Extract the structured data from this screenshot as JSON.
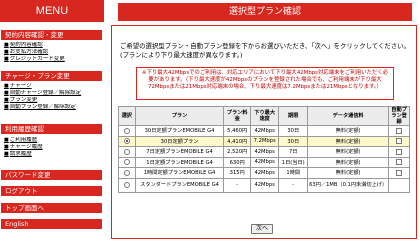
{
  "sidebar": {
    "title": "MENU",
    "sections": [
      {
        "heading": "契約内容確認・変更",
        "links": [
          "契約内容確認",
          "お支払方法確認",
          "クレジットカード変更"
        ]
      },
      {
        "heading": "チャージ・プラン変更",
        "links": [
          "チャージ",
          "自動チャージ登録／解除設定",
          "プラン変更",
          "自動プラン登録／解除設定"
        ]
      },
      {
        "heading": "利用履歴確認",
        "links": [
          "ご利用履歴",
          "チャージ履歴",
          "請求履歴"
        ]
      }
    ],
    "items": [
      "パスワード変更",
      "ログアウト",
      "トップ画面へ",
      "English"
    ]
  },
  "main": {
    "title": "選択型プラン確認",
    "intro": "ご希望の選択型プラン・自動プラン登録を下からお選びいただき、「次へ」をクリックしてください。(プランにより下り最大速度が異なります。)",
    "notice": "※下り最大42Mbpsでのご利用は、対応エリアにおいて下り最大42Mbps対応端末をご利用いただく必要があります。（下り最大速度が42Mbpsのプランを登録された場合でも、ご利用端末が下り最大72Mbpsまたは21Mbps対応端末の場合、下り最大速度は7.2Mbpsまたは21Mbpsとなります。）",
    "table": {
      "headers": [
        "選択",
        "プラン",
        "プラン料金",
        "下り最大速度",
        "期限",
        "データ通信料",
        "自動プラン登録"
      ],
      "rows": [
        {
          "selected": false,
          "plan": "30日定額プランEMOBILE G4",
          "price": "5,460円",
          "speed": "42Mbps",
          "term": "30日",
          "data": "無料(定額)",
          "highlight": false
        },
        {
          "selected": true,
          "plan": "30日定額プラン",
          "price": "4,410円",
          "speed": "7.2Mbps",
          "term": "30日",
          "data": "無料(定額)",
          "highlight": true
        },
        {
          "selected": false,
          "plan": "7日定額プランEMOBILE G4",
          "price": "2,520円",
          "speed": "42Mbps",
          "term": "7日",
          "data": "無料(定額)",
          "highlight": false
        },
        {
          "selected": false,
          "plan": "1日定額プランEMOBILE G4",
          "price": "630円",
          "speed": "42Mbps",
          "term": "1日(当日)",
          "data": "無料(定額)",
          "highlight": false
        },
        {
          "selected": false,
          "plan": "1時間定額プランEMOBILE G4",
          "price": "315円",
          "speed": "42Mbps",
          "term": "1時間",
          "data": "無料(定額)",
          "highlight": false
        },
        {
          "selected": false,
          "plan": "スタンダードプランEMOBILE G4",
          "price": "-",
          "speed": "42Mbps",
          "term": "-",
          "data": "63円／1MB（0.1円未満切上げ）",
          "highlight": false
        }
      ]
    },
    "next_label": "次へ"
  },
  "colors": {
    "accent": "#d8271f",
    "highlight_row": "#fff9cc"
  }
}
